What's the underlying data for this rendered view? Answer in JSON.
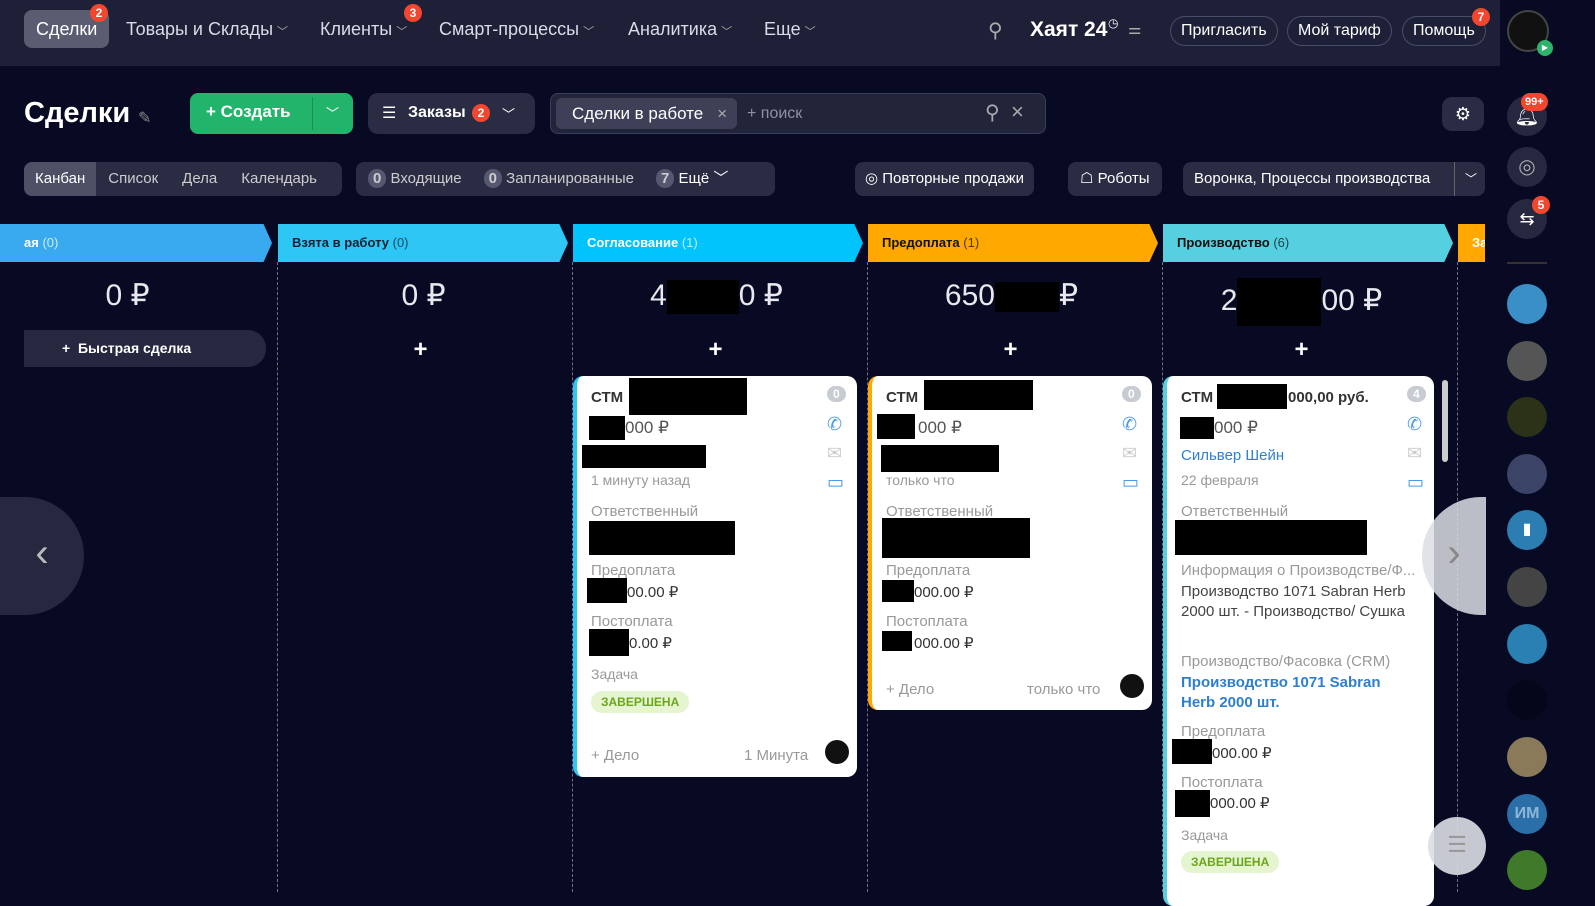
{
  "topnav": {
    "items": [
      {
        "label": "Сделки",
        "badge": "2"
      },
      {
        "label": "Товары и Склады"
      },
      {
        "label": "Клиенты",
        "badge": "3"
      },
      {
        "label": "Смарт-процессы"
      },
      {
        "label": "Аналитика"
      },
      {
        "label": "Еще"
      }
    ],
    "portal": "Хаят 24",
    "invite": "Пригласить",
    "tariff": "Мой тариф",
    "help": "Помощь",
    "help_badge": "7"
  },
  "header": {
    "title": "Сделки",
    "create": "Создать",
    "category": "Заказы",
    "category_badge": "2",
    "filter_chip": "Сделки в работе",
    "search_placeholder": "+ поиск"
  },
  "views": [
    "Канбан",
    "Список",
    "Дела",
    "Календарь"
  ],
  "counters": [
    {
      "n": "0",
      "label": "Входящие"
    },
    {
      "n": "0",
      "label": "Запланированные"
    },
    {
      "n": "7",
      "label": "Ещё"
    }
  ],
  "tools": {
    "repeat": "Повторные продажи",
    "robots": "Роботы",
    "pipeline": "Воронка, Процессы производства"
  },
  "columns": [
    {
      "name": "ая",
      "count": "(0)",
      "total": "0 ₽",
      "color": "#39a9f0"
    },
    {
      "name": "Взята в работу",
      "count": "(0)",
      "total": "0 ₽",
      "color": "#2ec7f5"
    },
    {
      "name": "Согласование",
      "count": "(1)",
      "total_left": "4",
      "total_right": "0 ₽",
      "color": "#00c4fb"
    },
    {
      "name": "Предоплата",
      "count": "(1)",
      "total_left": "650",
      "total_right": "₽",
      "color": "#ffa900"
    },
    {
      "name": "Производство",
      "count": "(6)",
      "total_left": "2",
      "total_right": "00 ₽",
      "color": "#55d0e0"
    },
    {
      "name": "За",
      "color": "#ffa900"
    }
  ],
  "quick_deal": "Быстрая сделка",
  "cards": [
    {
      "title": "СТМ",
      "counter": "0",
      "sum": "000 ₽",
      "time": "1 минуту назад",
      "resp_label": "Ответственный",
      "pre_label": "Предоплата",
      "pre": "00.00 ₽",
      "post_label": "Постоплата",
      "post": "0.00 ₽",
      "task_label": "Задача",
      "task_status": "ЗАВЕРШЕНА",
      "add": "+ Дело",
      "footer_time": "1 Минута"
    },
    {
      "title": "СТМ",
      "counter": "0",
      "sum": "000 ₽",
      "time": "только что",
      "resp_label": "Ответственный",
      "pre_label": "Предоплата",
      "pre": "000.00 ₽",
      "post_label": "Постоплата",
      "post": "000.00 ₽",
      "add": "+ Дело",
      "footer_time": "только что"
    },
    {
      "title": "СТМ",
      "title_suffix": "000,00 руб.",
      "counter": "4",
      "sum": "000 ₽",
      "contact": "Сильвер Шейн",
      "time": "22 февраля",
      "resp_label": "Ответственный",
      "info_label": "Информация о Производстве/Ф...",
      "info": "Производство 1071 Sabran Herb 2000 шт. - Производство/ Сушка",
      "prod_label": "Производство/Фасовка (CRM)",
      "prod_link": "Производство 1071 Sabran Herb 2000 шт.",
      "pre_label": "Предоплата",
      "pre": "000.00 ₽",
      "post_label": "Постоплата",
      "post": "000.00 ₽",
      "task_label": "Задача",
      "task_status": "ЗАВЕРШЕНА"
    }
  ],
  "right": {
    "notif_badge": "99+",
    "chat_badge": "5",
    "im": "ИМ"
  }
}
